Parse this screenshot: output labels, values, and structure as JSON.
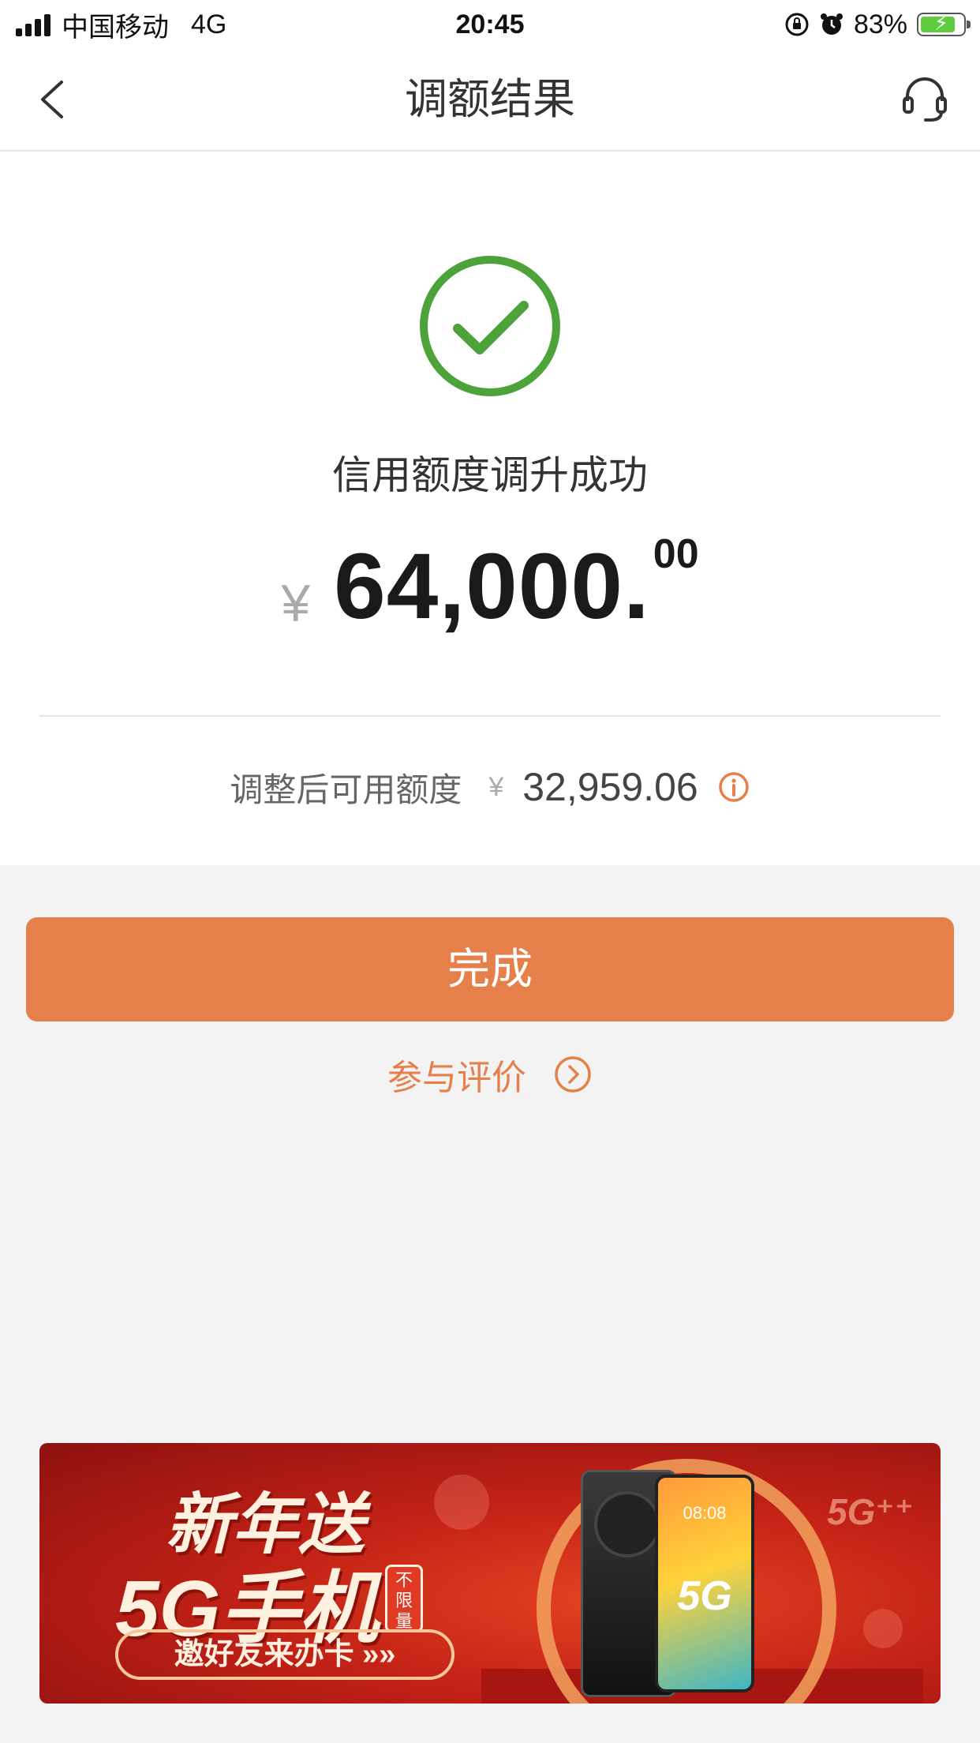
{
  "status_bar": {
    "carrier": "中国移动",
    "network": "4G",
    "time": "20:45",
    "battery_percent": "83%",
    "battery_level": 0.83
  },
  "nav": {
    "title": "调额结果",
    "icons": [
      "back-chevron-icon",
      "customer-service-headset-icon"
    ]
  },
  "result": {
    "status_icon": "success-check-icon",
    "title": "信用额度调升成功",
    "currency_symbol": "¥",
    "amount_integer": "64,000.",
    "amount_decimal": "00",
    "available_label": "调整后可用额度",
    "available_currency": "¥",
    "available_value": "32,959.06",
    "info_icon": "info-icon"
  },
  "actions": {
    "done_label": "完成",
    "review_label": "参与评价",
    "review_icon": "circle-chevron-right-icon"
  },
  "banner": {
    "line1": "新年送",
    "line2": "5G手机",
    "tag": "不限量",
    "cta": "邀好友来办卡 »»",
    "phone_time": "08:08",
    "phone_badge": "5G",
    "corner_badge": "5G⁺⁺"
  },
  "colors": {
    "accent": "#e5804a",
    "success": "#4ea23a",
    "page_bg": "#f4f3f3",
    "banner_red": "#c22116"
  }
}
